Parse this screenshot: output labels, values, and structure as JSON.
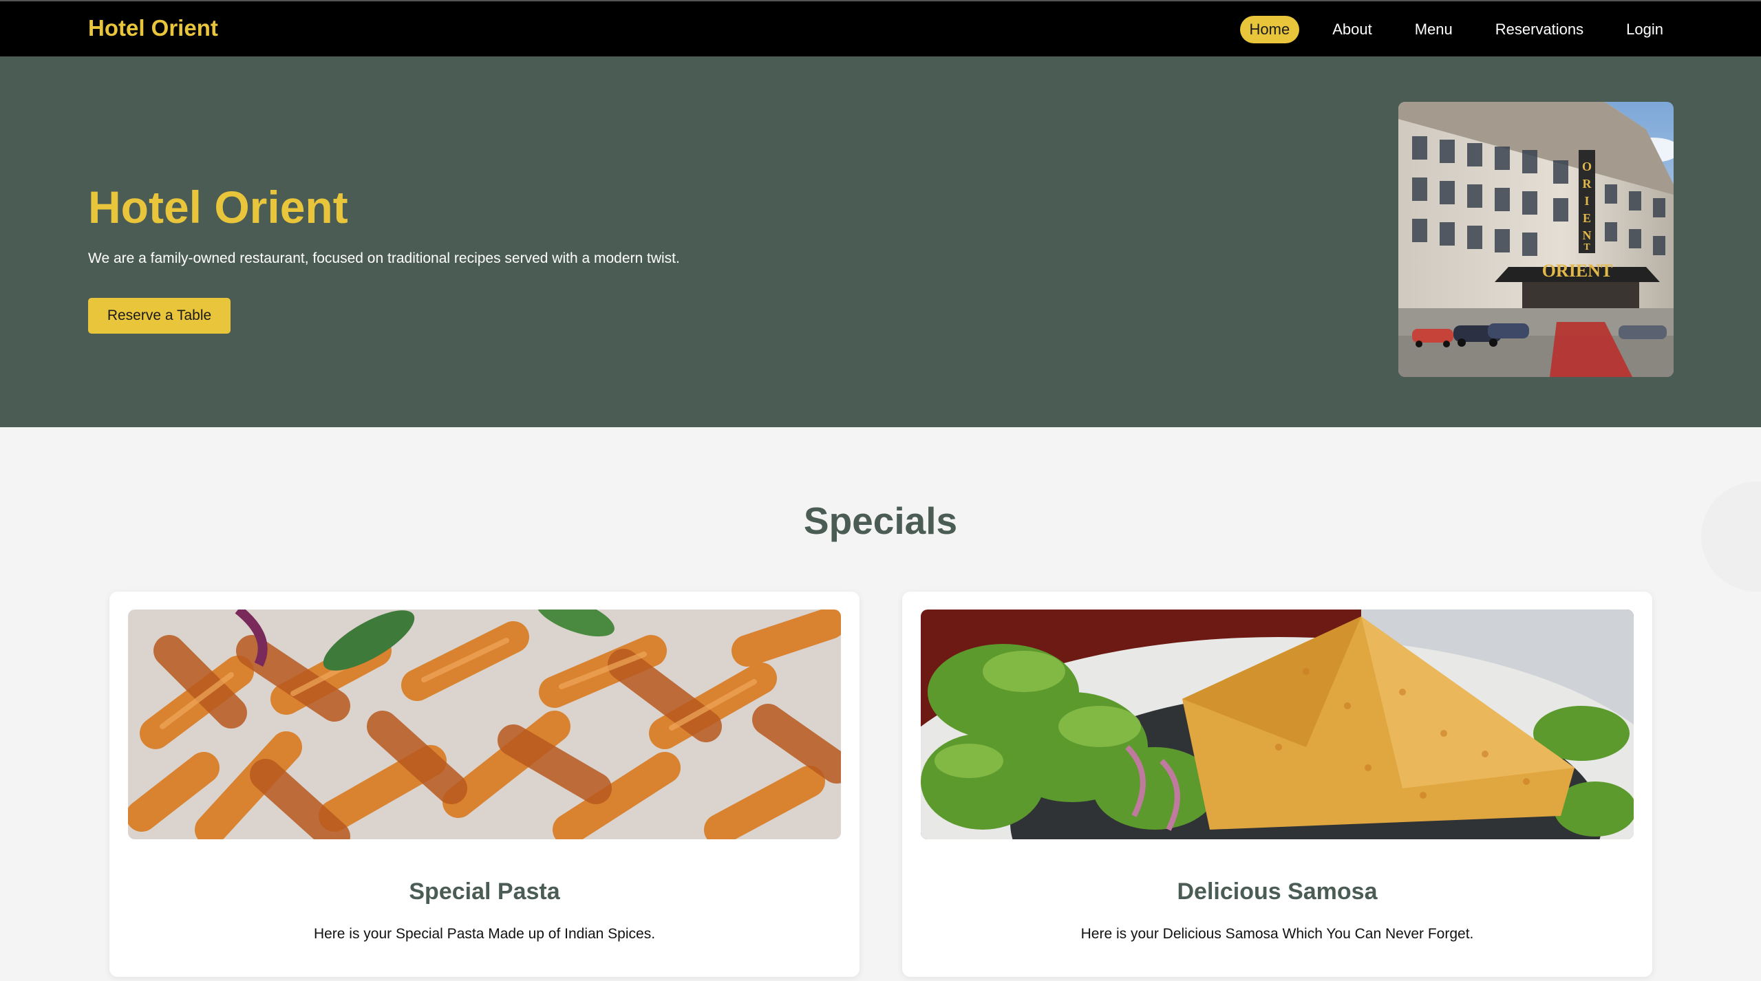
{
  "brand": "Hotel Orient",
  "nav": {
    "items": [
      {
        "label": "Home"
      },
      {
        "label": "About"
      },
      {
        "label": "Menu"
      },
      {
        "label": "Reservations"
      },
      {
        "label": "Login"
      }
    ],
    "active_index": 0
  },
  "hero": {
    "title": "Hotel Orient",
    "tagline": "We are a family-owned restaurant, focused on traditional recipes served with a modern twist.",
    "cta_label": "Reserve a Table",
    "image_sign": "ORIENT"
  },
  "specials": {
    "title": "Specials",
    "cards": [
      {
        "title": "Special Pasta",
        "description": "Here is your Special Pasta Made up of Indian Spices."
      },
      {
        "title": "Delicious Samosa",
        "description": "Here is your Delicious Samosa Which You Can Never Forget."
      }
    ]
  },
  "colors": {
    "accent": "#e9c53c",
    "hero_bg": "#4b5c55",
    "nav_bg": "#000000",
    "page_bg": "#f4f4f4"
  }
}
